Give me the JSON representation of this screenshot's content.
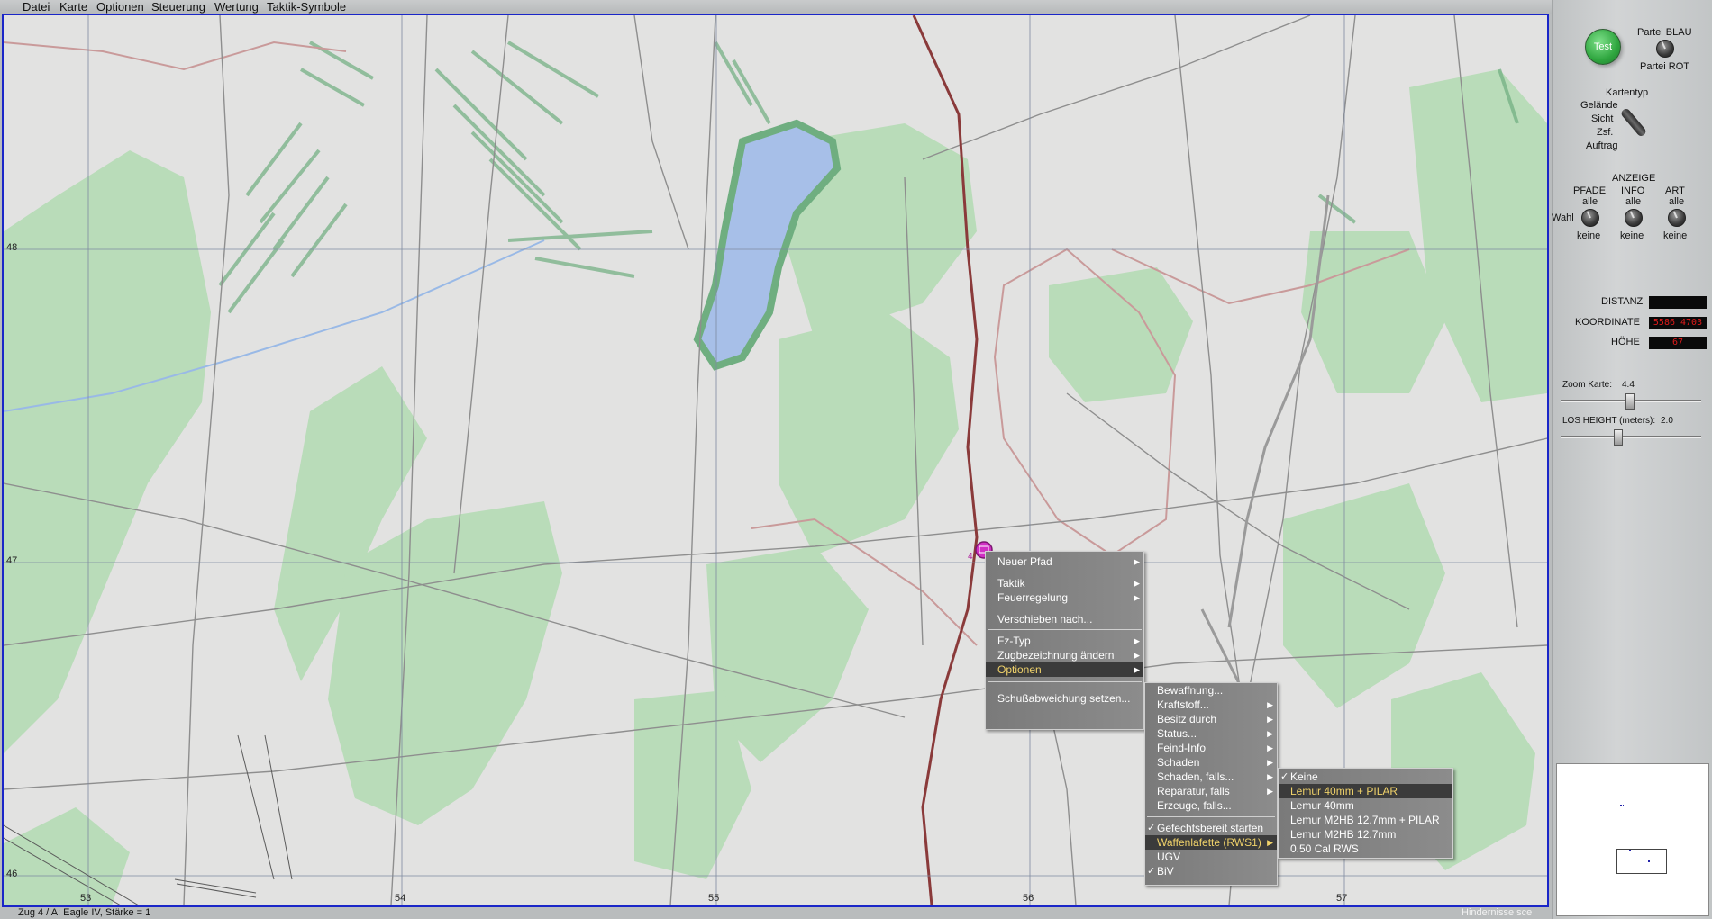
{
  "menubar": {
    "items": [
      "Datei",
      "Karte",
      "Optionen",
      "Steuerung",
      "Wertung",
      "Taktik-Symbole"
    ]
  },
  "map": {
    "x_ticks": [
      "53",
      "54",
      "55",
      "56",
      "57"
    ],
    "y_ticks": [
      "48",
      "47",
      "46"
    ],
    "unit_label": "4",
    "colors": {
      "background": "#e2e2e1",
      "forest": "#b8dcb8",
      "water": "#a7bfe8",
      "road": "#8a3a3a",
      "frame": "#1a26c8"
    }
  },
  "status": {
    "unit_text": "Zug 4 / A:  Eagle IV,  Stärke = 1",
    "right_text": "Hindernisse sce"
  },
  "panel": {
    "test_button": "Test",
    "party_blue": "Partei BLAU",
    "party_red": "Partei ROT",
    "map_type_title": "Kartentyp",
    "map_type_options": [
      "Gelände",
      "Sicht",
      "Zsf.",
      "Auftrag"
    ],
    "anzeige_title": "ANZEIGE",
    "dial_groups": [
      {
        "title": "PFADE",
        "top": "alle",
        "bottom": "keine"
      },
      {
        "title": "INFO",
        "top": "alle",
        "bottom": "keine"
      },
      {
        "title": "ART",
        "top": "alle",
        "bottom": "keine"
      }
    ],
    "wahl_label": "Wahl",
    "distanz_label": "DISTANZ",
    "distanz_value": "",
    "koordinate_label": "KOORDINATE",
    "koordinate_value": "5586 4703",
    "hoehe_label": "HÖHE",
    "hoehe_value": "67",
    "zoom_label": "Zoom Karte:",
    "zoom_value": "4.4",
    "los_label": "LOS HEIGHT (meters):",
    "los_value": "2.0"
  },
  "context_menu": {
    "items": [
      {
        "label": "Neuer Pfad",
        "submenu": true
      },
      {
        "label": "Taktik",
        "submenu": true
      },
      {
        "label": "Feuerregelung",
        "submenu": true
      },
      {
        "label": "Verschieben nach...",
        "submenu": false
      },
      {
        "label": "Fz-Typ",
        "submenu": true
      },
      {
        "label": "Zugbezeichnung ändern",
        "submenu": true
      },
      {
        "label": "Optionen",
        "submenu": true,
        "highlighted": true
      },
      {
        "label": "Schußabweichung setzen...",
        "submenu": false
      }
    ]
  },
  "options_menu": {
    "items": [
      {
        "label": "Bewaffnung...",
        "submenu": false
      },
      {
        "label": "Kraftstoff...",
        "submenu": true
      },
      {
        "label": "Besitz durch",
        "submenu": true
      },
      {
        "label": "Status...",
        "submenu": true
      },
      {
        "label": "Feind-Info",
        "submenu": true
      },
      {
        "label": "Schaden",
        "submenu": true
      },
      {
        "label": "Schaden, falls...",
        "submenu": true
      },
      {
        "label": "Reparatur, falls",
        "submenu": true
      },
      {
        "label": "Erzeuge, falls...",
        "submenu": false
      },
      {
        "label": "Gefechtsbereit starten",
        "checked": true
      },
      {
        "label": "Waffenlafette (RWS1)",
        "submenu": true,
        "highlighted": true
      },
      {
        "label": "UGV",
        "submenu": false
      },
      {
        "label": "BiV",
        "checked": true
      }
    ]
  },
  "weapon_menu": {
    "items": [
      {
        "label": "Keine",
        "checked": true
      },
      {
        "label": "Lemur 40mm + PILAR",
        "highlighted": true
      },
      {
        "label": "Lemur 40mm"
      },
      {
        "label": "Lemur M2HB 12.7mm + PILAR"
      },
      {
        "label": "Lemur M2HB 12.7mm"
      },
      {
        "label": "0.50 Cal RWS"
      }
    ]
  }
}
